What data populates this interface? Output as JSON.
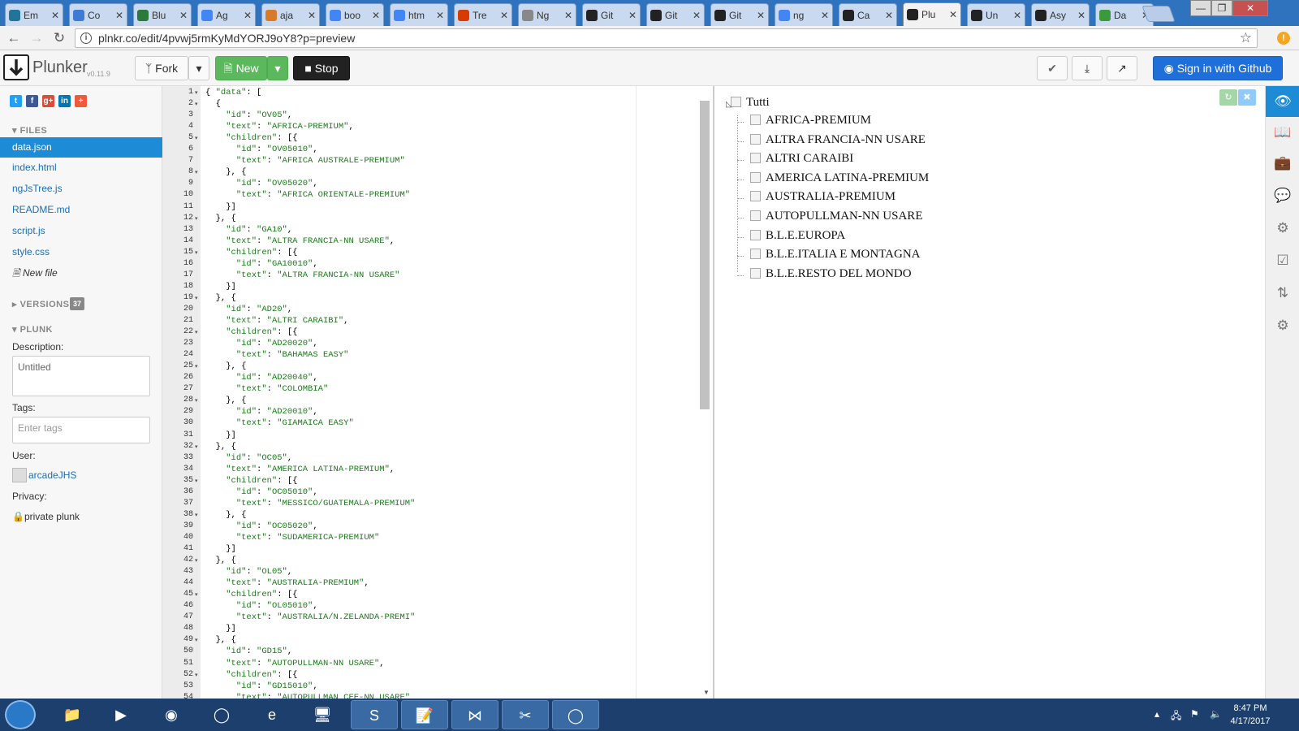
{
  "browser": {
    "tabs": [
      {
        "label": "Em",
        "icon": "wordpress-icon",
        "color": "#21759b"
      },
      {
        "label": "Co",
        "icon": "star-icon",
        "color": "#3d7bd5"
      },
      {
        "label": "Blu",
        "icon": "chart-icon",
        "color": "#2b7a3b"
      },
      {
        "label": "Ag",
        "icon": "google-icon",
        "color": "#4285f4"
      },
      {
        "label": "aja",
        "icon": "cloud-icon",
        "color": "#d67b2a"
      },
      {
        "label": "boo",
        "icon": "google-icon",
        "color": "#4285f4"
      },
      {
        "label": "htm",
        "icon": "google-icon",
        "color": "#4285f4"
      },
      {
        "label": "Tre",
        "icon": "grid-icon",
        "color": "#d83b01"
      },
      {
        "label": "Ng",
        "icon": "page-icon",
        "color": "#888888"
      },
      {
        "label": "Git",
        "icon": "github-icon",
        "color": "#222222"
      },
      {
        "label": "Git",
        "icon": "github-icon",
        "color": "#222222"
      },
      {
        "label": "Git",
        "icon": "github-icon",
        "color": "#222222"
      },
      {
        "label": "ng",
        "icon": "google-icon",
        "color": "#4285f4"
      },
      {
        "label": "Ca",
        "icon": "github-icon",
        "color": "#222222"
      },
      {
        "label": "Plu",
        "icon": "plunker-icon",
        "color": "#222222"
      },
      {
        "label": "Un",
        "icon": "github-icon",
        "color": "#222222"
      },
      {
        "label": "Asy",
        "icon": "github-icon",
        "color": "#222222"
      },
      {
        "label": "Da",
        "icon": "leaf-icon",
        "color": "#3c9a3c"
      }
    ],
    "url": "plnkr.co/edit/4pvwj5rmKyMdYORJ9oY8?p=preview"
  },
  "toolbar": {
    "brand": "Plunker",
    "version": "v0.11.9",
    "fork": "Fork",
    "new": "New",
    "stop": "Stop",
    "signin": "Sign in with Github"
  },
  "sidebar": {
    "files_header": "FILES",
    "files": [
      "data.json",
      "index.html",
      "ngJsTree.js",
      "README.md",
      "script.js",
      "style.css"
    ],
    "new_file": "New file",
    "versions_header": "VERSIONS",
    "versions_count": "37",
    "plunk_header": "PLUNK",
    "description_label": "Description:",
    "description_value": "Untitled",
    "tags_label": "Tags:",
    "tags_placeholder": "Enter tags",
    "user_label": "User:",
    "user_name": "arcadeJHS",
    "privacy_label": "Privacy:",
    "privacy_value": "private plunk"
  },
  "editor": {
    "lines": [
      "{ \"data\": [",
      "  {",
      "    \"id\": \"OV05\",",
      "    \"text\": \"AFRICA-PREMIUM\",",
      "    \"children\": [{",
      "      \"id\": \"OV05010\",",
      "      \"text\": \"AFRICA AUSTRALE-PREMIUM\"",
      "    }, {",
      "      \"id\": \"OV05020\",",
      "      \"text\": \"AFRICA ORIENTALE-PREMIUM\"",
      "    }]",
      "  }, {",
      "    \"id\": \"GA10\",",
      "    \"text\": \"ALTRA FRANCIA-NN USARE\",",
      "    \"children\": [{",
      "      \"id\": \"GA10010\",",
      "      \"text\": \"ALTRA FRANCIA-NN USARE\"",
      "    }]",
      "  }, {",
      "    \"id\": \"AD20\",",
      "    \"text\": \"ALTRI CARAIBI\",",
      "    \"children\": [{",
      "      \"id\": \"AD20020\",",
      "      \"text\": \"BAHAMAS EASY\"",
      "    }, {",
      "      \"id\": \"AD20040\",",
      "      \"text\": \"COLOMBIA\"",
      "    }, {",
      "      \"id\": \"AD20010\",",
      "      \"text\": \"GIAMAICA EASY\"",
      "    }]",
      "  }, {",
      "    \"id\": \"OC05\",",
      "    \"text\": \"AMERICA LATINA-PREMIUM\",",
      "    \"children\": [{",
      "      \"id\": \"OC05010\",",
      "      \"text\": \"MESSICO/GUATEMALA-PREMIUM\"",
      "    }, {",
      "      \"id\": \"OC05020\",",
      "      \"text\": \"SUDAMERICA-PREMIUM\"",
      "    }]",
      "  }, {",
      "    \"id\": \"OL05\",",
      "    \"text\": \"AUSTRALIA-PREMIUM\",",
      "    \"children\": [{",
      "      \"id\": \"OL05010\",",
      "      \"text\": \"AUSTRALIA/N.ZELANDA-PREMI\"",
      "    }]",
      "  }, {",
      "    \"id\": \"GD15\",",
      "    \"text\": \"AUTOPULLMAN-NN USARE\",",
      "    \"children\": [{",
      "      \"id\": \"GD15010\",",
      "      \"text\": \"AUTOPULLMAN CEE-NN USARE\""
    ],
    "fold_lines": [
      1,
      2,
      5,
      8,
      12,
      15,
      19,
      22,
      25,
      28,
      32,
      35,
      38,
      42,
      45,
      49,
      52
    ]
  },
  "preview": {
    "root": "Tutti",
    "nodes": [
      "AFRICA-PREMIUM",
      "ALTRA FRANCIA-NN USARE",
      "ALTRI CARAIBI",
      "AMERICA LATINA-PREMIUM",
      "AUSTRALIA-PREMIUM",
      "AUTOPULLMAN-NN USARE",
      "B.L.E.EUROPA",
      "B.L.E.ITALIA E MONTAGNA",
      "B.L.E.RESTO DEL MONDO"
    ]
  },
  "taskbar": {
    "time": "8:47 PM",
    "date": "4/17/2017"
  }
}
